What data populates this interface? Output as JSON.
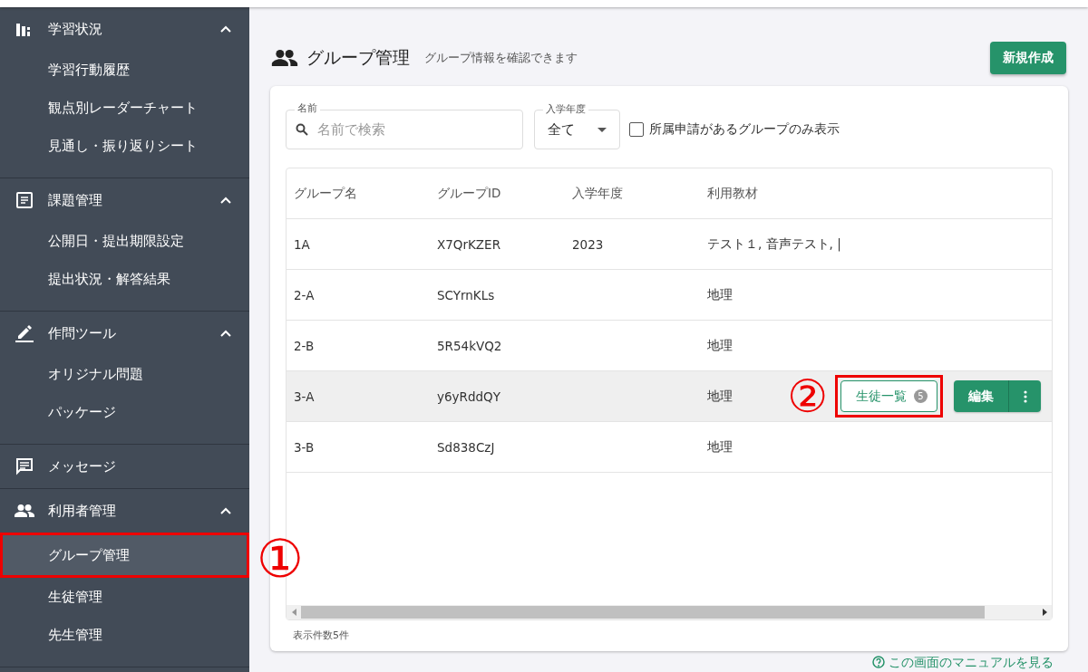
{
  "sidebar": {
    "sections": [
      {
        "label": "学習状況",
        "expanded": true,
        "items": [
          {
            "label": "学習行動履歴",
            "selected": false,
            "annotated": false
          },
          {
            "label": "観点別レーダーチャート",
            "selected": false,
            "annotated": false
          },
          {
            "label": "見通し・振り返りシート",
            "selected": false,
            "annotated": false
          }
        ]
      },
      {
        "label": "課題管理",
        "expanded": true,
        "items": [
          {
            "label": "公開日・提出期限設定",
            "selected": false,
            "annotated": false
          },
          {
            "label": "提出状況・解答結果",
            "selected": false,
            "annotated": false
          }
        ]
      },
      {
        "label": "作問ツール",
        "expanded": true,
        "items": [
          {
            "label": "オリジナル問題",
            "selected": false,
            "annotated": false
          },
          {
            "label": "パッケージ",
            "selected": false,
            "annotated": false
          }
        ]
      },
      {
        "label": "メッセージ"
      },
      {
        "label": "利用者管理",
        "expanded": true,
        "items": [
          {
            "label": "グループ管理",
            "selected": true,
            "annotated": true
          },
          {
            "label": "生徒管理",
            "selected": false,
            "annotated": false
          },
          {
            "label": "先生管理",
            "selected": false,
            "annotated": false
          }
        ]
      }
    ]
  },
  "header": {
    "title": "グループ管理",
    "subtitle": "グループ情報を確認できます",
    "new_button": "新規作成"
  },
  "filters": {
    "name": {
      "label": "名前",
      "placeholder": "名前で検索"
    },
    "year": {
      "label": "入学年度",
      "value": "全て"
    },
    "pending_only": {
      "label": "所属申請があるグループのみ表示",
      "checked": false
    }
  },
  "table": {
    "columns": [
      "グループ名",
      "グループID",
      "入学年度",
      "利用教材"
    ],
    "rows": [
      {
        "cells": [
          "1A",
          "X7QrKZER",
          "2023",
          "テスト１, 音声テスト, |"
        ],
        "hovered": false
      },
      {
        "cells": [
          "2-A",
          "SCYrnKLs",
          "",
          "地理"
        ],
        "hovered": false
      },
      {
        "cells": [
          "2-B",
          "5R54kVQ2",
          "",
          "地理"
        ],
        "hovered": false
      },
      {
        "cells": [
          "3-A",
          "y6yRddQY",
          "",
          "地理"
        ],
        "hovered": true,
        "actions": {
          "students": "生徒一覧",
          "count": "5",
          "edit": "編集",
          "annotated": true
        }
      },
      {
        "cells": [
          "3-B",
          "Sd838CzJ",
          "",
          "地理"
        ],
        "hovered": false
      }
    ]
  },
  "count_text": "表示件数5件",
  "manual_link": "この画面のマニュアルを見る",
  "annotations": [
    "①",
    "②"
  ]
}
